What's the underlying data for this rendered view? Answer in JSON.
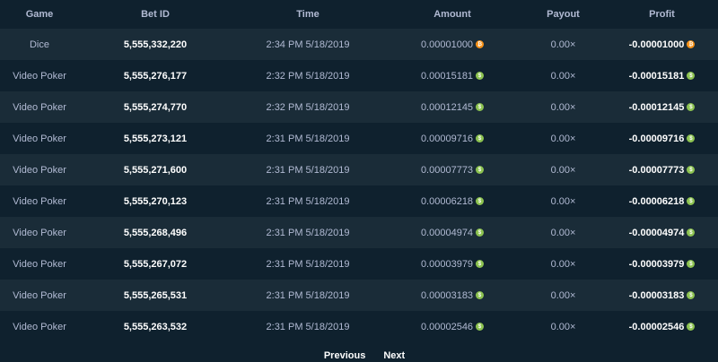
{
  "colors": {
    "background": "#0f212e",
    "row_alt": "#1a2c38",
    "btc_coin": "#f7931a",
    "bch_coin": "#8dc351"
  },
  "table": {
    "headers": {
      "game": "Game",
      "bet_id": "Bet ID",
      "time": "Time",
      "amount": "Amount",
      "payout": "Payout",
      "profit": "Profit"
    },
    "rows": [
      {
        "game": "Dice",
        "bet_id": "5,555,332,220",
        "time": "2:34 PM 5/18/2019",
        "amount": "0.00001000",
        "payout": "0.00×",
        "profit": "-0.00001000",
        "coin": "btc"
      },
      {
        "game": "Video Poker",
        "bet_id": "5,555,276,177",
        "time": "2:32 PM 5/18/2019",
        "amount": "0.00015181",
        "payout": "0.00×",
        "profit": "-0.00015181",
        "coin": "bch"
      },
      {
        "game": "Video Poker",
        "bet_id": "5,555,274,770",
        "time": "2:32 PM 5/18/2019",
        "amount": "0.00012145",
        "payout": "0.00×",
        "profit": "-0.00012145",
        "coin": "bch"
      },
      {
        "game": "Video Poker",
        "bet_id": "5,555,273,121",
        "time": "2:31 PM 5/18/2019",
        "amount": "0.00009716",
        "payout": "0.00×",
        "profit": "-0.00009716",
        "coin": "bch"
      },
      {
        "game": "Video Poker",
        "bet_id": "5,555,271,600",
        "time": "2:31 PM 5/18/2019",
        "amount": "0.00007773",
        "payout": "0.00×",
        "profit": "-0.00007773",
        "coin": "bch"
      },
      {
        "game": "Video Poker",
        "bet_id": "5,555,270,123",
        "time": "2:31 PM 5/18/2019",
        "amount": "0.00006218",
        "payout": "0.00×",
        "profit": "-0.00006218",
        "coin": "bch"
      },
      {
        "game": "Video Poker",
        "bet_id": "5,555,268,496",
        "time": "2:31 PM 5/18/2019",
        "amount": "0.00004974",
        "payout": "0.00×",
        "profit": "-0.00004974",
        "coin": "bch"
      },
      {
        "game": "Video Poker",
        "bet_id": "5,555,267,072",
        "time": "2:31 PM 5/18/2019",
        "amount": "0.00003979",
        "payout": "0.00×",
        "profit": "-0.00003979",
        "coin": "bch"
      },
      {
        "game": "Video Poker",
        "bet_id": "5,555,265,531",
        "time": "2:31 PM 5/18/2019",
        "amount": "0.00003183",
        "payout": "0.00×",
        "profit": "-0.00003183",
        "coin": "bch"
      },
      {
        "game": "Video Poker",
        "bet_id": "5,555,263,532",
        "time": "2:31 PM 5/18/2019",
        "amount": "0.00002546",
        "payout": "0.00×",
        "profit": "-0.00002546",
        "coin": "bch"
      }
    ]
  },
  "pagination": {
    "previous": "Previous",
    "next": "Next"
  }
}
